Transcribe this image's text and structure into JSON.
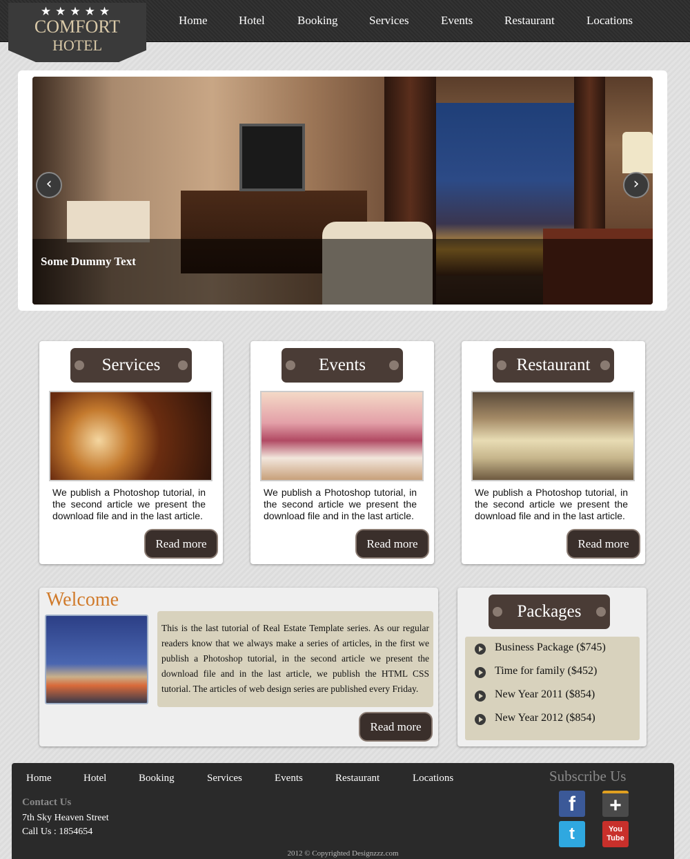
{
  "header": {
    "logo": {
      "stars": "★★★★★",
      "line1": "COMFORT",
      "line2": "HOTEL"
    },
    "nav": [
      "Home",
      "Hotel",
      "Booking",
      "Services",
      "Events",
      "Restaurant",
      "Locations"
    ]
  },
  "slider": {
    "caption": "Some Dummy Text",
    "prev_icon": "‹",
    "next_icon": "›"
  },
  "cards": [
    {
      "title": "Services",
      "text": "We publish a Photoshop tutorial, in the second article we present the download file and in the last article.",
      "button": "Read more"
    },
    {
      "title": "Events",
      "text": "We publish a Photoshop tutorial, in the second article we present the download file and in the last article.",
      "button": "Read more"
    },
    {
      "title": "Restaurant",
      "text": "We publish a Photoshop tutorial, in the second article we present the download file and in the last article.",
      "button": "Read more"
    }
  ],
  "welcome": {
    "title": "Welcome",
    "text": "This is the last tutorial of Real Estate Template series. As our regular readers know that we always make a series of articles, in the first we publish a Photoshop tutorial, in the second article we present the download file and in the last article, we publish the HTML CSS tutorial. The articles of web design series are published every Friday.",
    "button": "Read more"
  },
  "packages": {
    "title": "Packages",
    "items": [
      "Business Package ($745)",
      "Time for family ($452)",
      "New Year 2011 ($854)",
      "New Year 2012 ($854)"
    ]
  },
  "footer": {
    "nav": [
      "Home",
      "Hotel",
      "Booking",
      "Services",
      "Events",
      "Restaurant",
      "Locations"
    ],
    "contact_title": "Contact Us",
    "address": "7th Sky Heaven Street",
    "phone": "Call Us : 1854654",
    "subscribe": "Subscribe Us",
    "social": [
      {
        "name": "facebook-icon",
        "glyph": "f",
        "color": "#3b5998"
      },
      {
        "name": "google-plus-icon",
        "glyph": "+",
        "color": "#4a4a4a"
      },
      {
        "name": "twitter-icon",
        "glyph": "t",
        "color": "#2fa8e0"
      },
      {
        "name": "youtube-icon",
        "glyph": "You Tube",
        "color": "#c8302b"
      }
    ],
    "copyright": "2012 © Copyrighted Designzzz.com"
  },
  "colors": {
    "accent_orange": "#d07a2a",
    "pill_brown": "#4a3c36",
    "panel_beige": "#d8d2bd",
    "footer_dark": "#2a2a2a"
  }
}
